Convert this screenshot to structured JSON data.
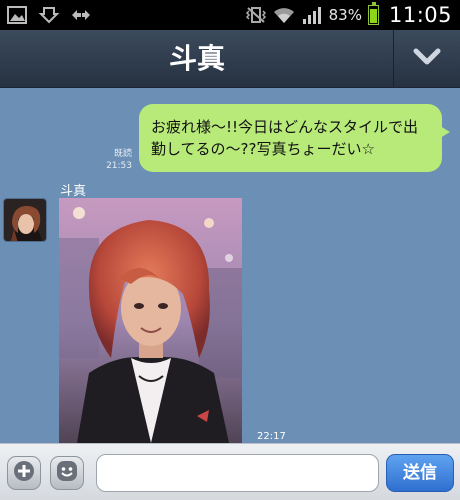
{
  "status_bar": {
    "left_icons": [
      "gallery-icon",
      "download-icon",
      "data-arrows-icon"
    ],
    "right_icons": [
      "vibrate-icon",
      "wifi-icon",
      "signal-icon",
      "battery-icon"
    ],
    "battery_percent": "83%",
    "battery_level": 0.83,
    "time": "11:05"
  },
  "header": {
    "title": "斗真",
    "menu_icon": "chevron-down-icon"
  },
  "chat": {
    "outgoing": {
      "text": "お疲れ様〜!!今日はどんなスタイルで出勤してるの〜??写真ちょーだい☆",
      "read_label": "既読",
      "time": "21:53"
    },
    "incoming": {
      "sender": "斗真",
      "time": "22:17"
    }
  },
  "input_bar": {
    "plus_icon": "plus-icon",
    "sticker_icon": "smiley-icon",
    "message_value": "",
    "send_label": "送信"
  },
  "colors": {
    "chat_background": "#6b8fb5",
    "outgoing_bubble": "#b8ea79",
    "header": "#2f3b4c",
    "send_button": "#3b82e0"
  }
}
